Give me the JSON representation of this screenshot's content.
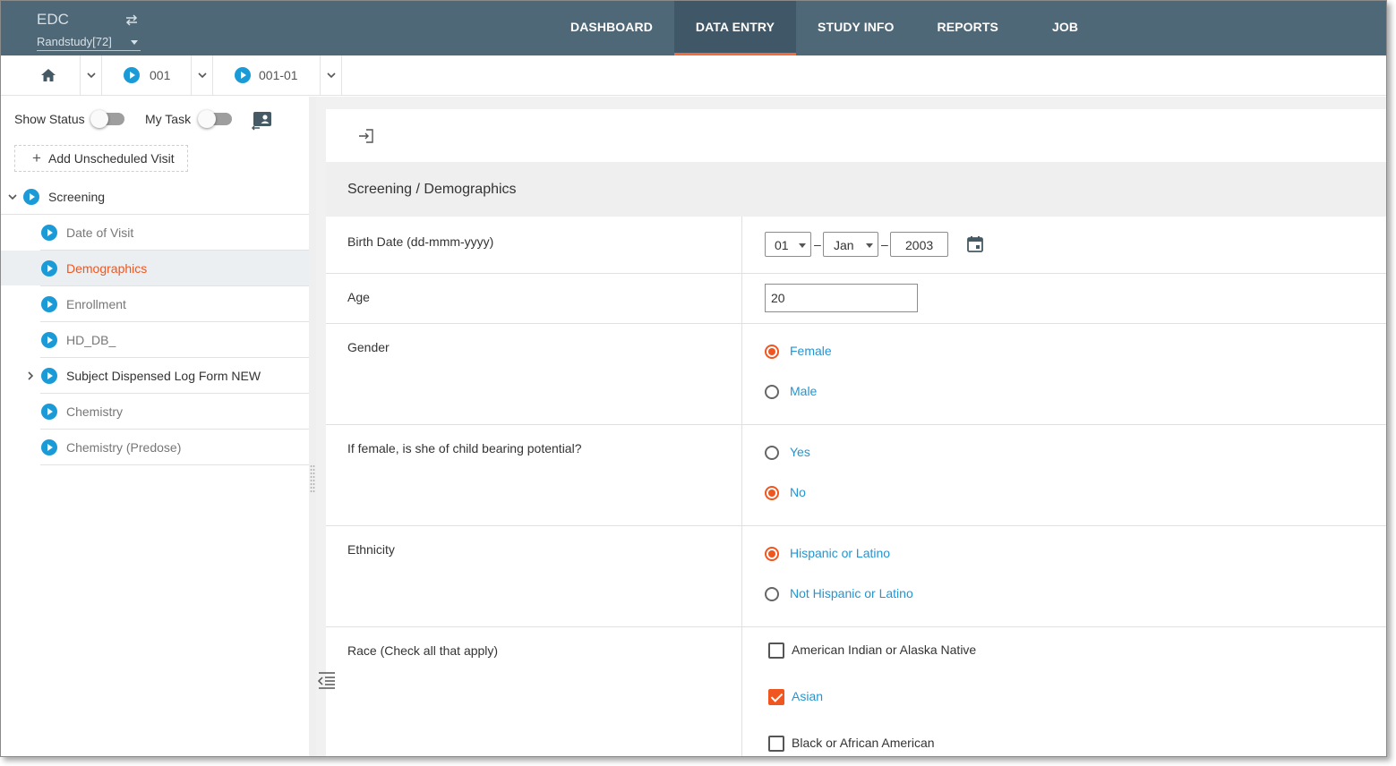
{
  "header": {
    "app_title": "EDC",
    "study": "Randstudy[72]",
    "nav": [
      {
        "label": "DASHBOARD",
        "active": false
      },
      {
        "label": "DATA ENTRY",
        "active": true
      },
      {
        "label": "STUDY INFO",
        "active": false
      },
      {
        "label": "REPORTS",
        "active": false
      },
      {
        "label": "JOB",
        "active": false
      }
    ],
    "accent_color": "#f26b3a",
    "bar_color": "#4e6878"
  },
  "breadcrumb": {
    "home_icon": "home-icon",
    "site": "001",
    "subject": "001-01"
  },
  "sidebar": {
    "show_status_label": "Show Status",
    "show_status_on": false,
    "my_task_label": "My Task",
    "my_task_on": false,
    "add_visit_label": "Add Unscheduled Visit",
    "visit": {
      "label": "Screening",
      "expanded": true
    },
    "forms": [
      {
        "label": "Date of Visit",
        "selected": false,
        "expandable": false
      },
      {
        "label": "Demographics",
        "selected": true,
        "expandable": false
      },
      {
        "label": "Enrollment",
        "selected": false,
        "expandable": false
      },
      {
        "label": "HD_DB_",
        "selected": false,
        "expandable": false
      },
      {
        "label": "Subject Dispensed Log Form NEW",
        "selected": false,
        "expandable": true
      },
      {
        "label": "Chemistry",
        "selected": false,
        "expandable": false
      },
      {
        "label": "Chemistry (Predose)",
        "selected": false,
        "expandable": false
      }
    ]
  },
  "form": {
    "title": "Screening / Demographics",
    "birth_date": {
      "label": "Birth Date (dd-mmm-yyyy)",
      "day": "01",
      "month": "Jan",
      "year": "2003",
      "separator": "–"
    },
    "age": {
      "label": "Age",
      "value": "20"
    },
    "gender": {
      "label": "Gender",
      "options": [
        {
          "label": "Female",
          "selected": true
        },
        {
          "label": "Male",
          "selected": false
        }
      ]
    },
    "child_bearing": {
      "label": "If female, is she of child bearing potential?",
      "options": [
        {
          "label": "Yes",
          "selected": false
        },
        {
          "label": "No",
          "selected": true
        }
      ]
    },
    "ethnicity": {
      "label": "Ethnicity",
      "options": [
        {
          "label": "Hispanic or Latino",
          "selected": true
        },
        {
          "label": "Not Hispanic or Latino",
          "selected": false
        }
      ]
    },
    "race": {
      "label": "Race (Check all that apply)",
      "options": [
        {
          "label": "American Indian or Alaska Native",
          "checked": false
        },
        {
          "label": "Asian",
          "checked": true
        },
        {
          "label": "Black or African American",
          "checked": false
        }
      ]
    }
  }
}
